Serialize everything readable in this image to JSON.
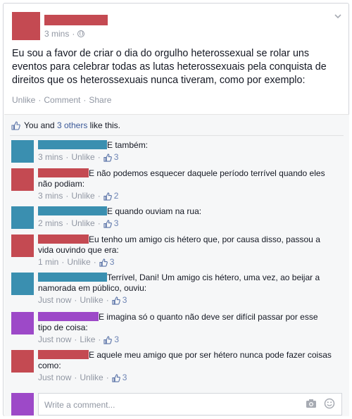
{
  "post": {
    "time": "3 mins",
    "dot": "·",
    "text": "Eu sou a favor de criar o dia do orgulho heterossexual se rolar uns eventos para celebrar todas as lutas heterossexuais pela conquista de direitos que os heterossexuais nunca tiveram, como por exemplo:",
    "actions": {
      "unlike": "Unlike",
      "comment": "Comment",
      "share": "Share",
      "sep": "·"
    }
  },
  "likes": {
    "prefix": "You and ",
    "count": "3 others",
    "suffix": " like this."
  },
  "comments": [
    {
      "color": "#3a8fb0",
      "text": "E também:",
      "time": "3 mins",
      "action": "Unlike",
      "likes": "3"
    },
    {
      "color": "#c44a52",
      "text": "E não podemos esquecer daquele período terrível quando eles não podiam:",
      "time": "3 mins",
      "action": "Unlike",
      "likes": "2"
    },
    {
      "color": "#3a8fb0",
      "text": "E quando ouviam na rua:",
      "time": "2 mins",
      "action": "Unlike",
      "likes": "3"
    },
    {
      "color": "#c44a52",
      "text": "Eu tenho um amigo cis hétero que, por causa disso, passou a vida ouvindo que era:",
      "time": "1 min",
      "action": "Unlike",
      "likes": "3"
    },
    {
      "color": "#3a8fb0",
      "text": "Terrível, Dani! Um amigo cis hétero, uma vez, ao beijar a namorada em público, ouviu:",
      "time": "Just now",
      "action": "Unlike",
      "likes": "3"
    },
    {
      "color": "#9d49c8",
      "text": "E imagina só o quanto não deve ser difícil passar por esse tipo de coisa:",
      "time": "Just now",
      "action": "Like",
      "likes": "3"
    },
    {
      "color": "#c44a52",
      "text": "E aquele meu amigo que por ser hétero nunca pode fazer coisas como:",
      "time": "Just now",
      "action": "Unlike",
      "likes": "3"
    }
  ],
  "reply": {
    "placeholder": "Write a comment..."
  },
  "icons": {
    "globe": "globe-icon",
    "like": "thumbs-up-icon",
    "camera": "camera-icon",
    "emoji": "smiley-icon",
    "menu": "chevron-down-icon"
  }
}
